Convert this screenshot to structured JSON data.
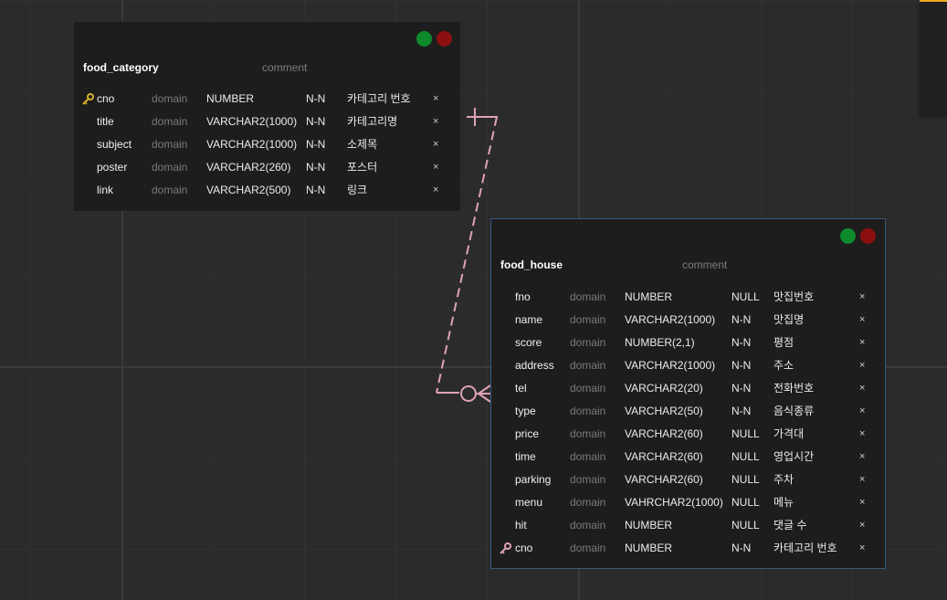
{
  "colors": {
    "background": "#2b2b2b",
    "table_bg": "#1d1d1d",
    "relation_line": "#e0a2b8",
    "primary_key_icon": "#d6b028",
    "foreign_key_icon": "#e0a2b8",
    "btn_green": "#0d8a2b",
    "btn_red": "#8c0f0f",
    "selected_border": "#355a7a"
  },
  "tables": [
    {
      "name": "food_category",
      "comment_placeholder": "comment",
      "columns": [
        {
          "key": "pk",
          "key_icon": "key-icon",
          "name": "cno",
          "domain": "domain",
          "type": "NUMBER",
          "nullable": "N-N",
          "comment": "카테고리 번호",
          "delete": "×"
        },
        {
          "key": "",
          "name": "title",
          "domain": "domain",
          "type": "VARCHAR2(1000)",
          "nullable": "N-N",
          "comment": "카테고리명",
          "delete": "×"
        },
        {
          "key": "",
          "name": "subject",
          "domain": "domain",
          "type": "VARCHAR2(1000)",
          "nullable": "N-N",
          "comment": "소제목",
          "delete": "×"
        },
        {
          "key": "",
          "name": "poster",
          "domain": "domain",
          "type": "VARCHAR2(260)",
          "nullable": "N-N",
          "comment": "포스터",
          "delete": "×"
        },
        {
          "key": "",
          "name": "link",
          "domain": "domain",
          "type": "VARCHAR2(500)",
          "nullable": "N-N",
          "comment": "링크",
          "delete": "×"
        }
      ]
    },
    {
      "name": "food_house",
      "comment_placeholder": "comment",
      "columns": [
        {
          "key": "",
          "name": "fno",
          "domain": "domain",
          "type": "NUMBER",
          "nullable": "NULL",
          "comment": "맛집번호",
          "delete": "×"
        },
        {
          "key": "",
          "name": "name",
          "domain": "domain",
          "type": "VARCHAR2(1000)",
          "nullable": "N-N",
          "comment": "맛집명",
          "delete": "×"
        },
        {
          "key": "",
          "name": "score",
          "domain": "domain",
          "type": "NUMBER(2,1)",
          "nullable": "N-N",
          "comment": "평점",
          "delete": "×"
        },
        {
          "key": "",
          "name": "address",
          "domain": "domain",
          "type": "VARCHAR2(1000)",
          "nullable": "N-N",
          "comment": "주소",
          "delete": "×"
        },
        {
          "key": "",
          "name": "tel",
          "domain": "domain",
          "type": "VARCHAR2(20)",
          "nullable": "N-N",
          "comment": "전화번호",
          "delete": "×"
        },
        {
          "key": "",
          "name": "type",
          "domain": "domain",
          "type": "VARCHAR2(50)",
          "nullable": "N-N",
          "comment": "음식종류",
          "delete": "×"
        },
        {
          "key": "",
          "name": "price",
          "domain": "domain",
          "type": "VARCHAR2(60)",
          "nullable": "NULL",
          "comment": "가격대",
          "delete": "×"
        },
        {
          "key": "",
          "name": "time",
          "domain": "domain",
          "type": "VARCHAR2(60)",
          "nullable": "NULL",
          "comment": "영업시간",
          "delete": "×"
        },
        {
          "key": "",
          "name": "parking",
          "domain": "domain",
          "type": "VARCHAR2(60)",
          "nullable": "NULL",
          "comment": "주차",
          "delete": "×"
        },
        {
          "key": "",
          "name": "menu",
          "domain": "domain",
          "type": "VAHRCHAR2(1000)",
          "nullable": "NULL",
          "comment": "메뉴",
          "delete": "×"
        },
        {
          "key": "",
          "name": "hit",
          "domain": "domain",
          "type": "NUMBER",
          "nullable": "NULL",
          "comment": "댓글 수",
          "delete": "×"
        },
        {
          "key": "fk",
          "key_icon": "key-icon",
          "name": "cno",
          "domain": "domain",
          "type": "NUMBER",
          "nullable": "N-N",
          "comment": "카테고리 번호",
          "delete": "×"
        }
      ]
    }
  ]
}
